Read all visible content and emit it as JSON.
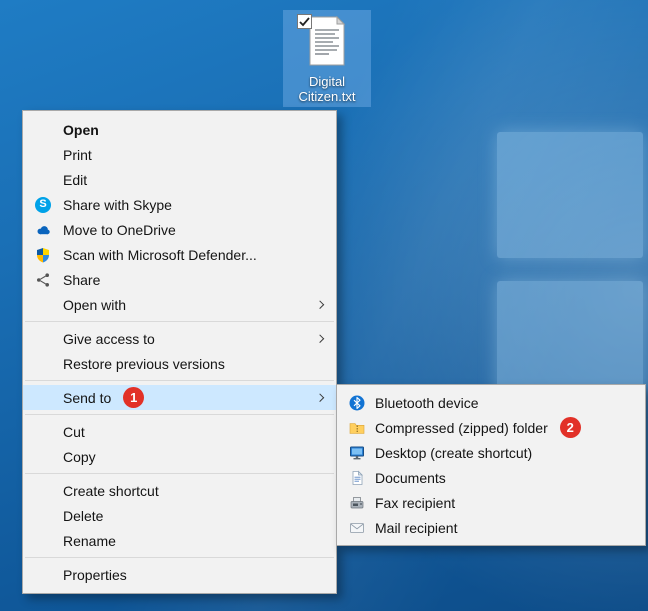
{
  "desktop": {
    "file": {
      "name": "Digital Citizen.txt"
    }
  },
  "context_menu": {
    "items": [
      {
        "label": "Open"
      },
      {
        "label": "Print"
      },
      {
        "label": "Edit"
      },
      {
        "label": "Share with Skype",
        "icon": "skype-icon"
      },
      {
        "label": "Move to OneDrive",
        "icon": "onedrive-icon"
      },
      {
        "label": "Scan with Microsoft Defender...",
        "icon": "defender-icon"
      },
      {
        "label": "Share",
        "icon": "share-icon"
      },
      {
        "label": "Open with"
      },
      {
        "label": "Give access to"
      },
      {
        "label": "Restore previous versions"
      },
      {
        "label": "Send to"
      },
      {
        "label": "Cut"
      },
      {
        "label": "Copy"
      },
      {
        "label": "Create shortcut"
      },
      {
        "label": "Delete"
      },
      {
        "label": "Rename"
      },
      {
        "label": "Properties"
      }
    ]
  },
  "send_to_submenu": {
    "items": [
      {
        "label": "Bluetooth device",
        "icon": "bluetooth-icon"
      },
      {
        "label": "Compressed (zipped) folder",
        "icon": "zip-folder-icon"
      },
      {
        "label": "Desktop (create shortcut)",
        "icon": "desktop-monitor-icon"
      },
      {
        "label": "Documents",
        "icon": "documents-icon"
      },
      {
        "label": "Fax recipient",
        "icon": "fax-icon"
      },
      {
        "label": "Mail recipient",
        "icon": "mail-icon"
      }
    ]
  },
  "annotations": {
    "step1": "1",
    "step2": "2"
  },
  "colors": {
    "menu_highlight": "#cde8ff",
    "annotation_red": "#e23128",
    "menu_bg": "#f2f2f2"
  }
}
